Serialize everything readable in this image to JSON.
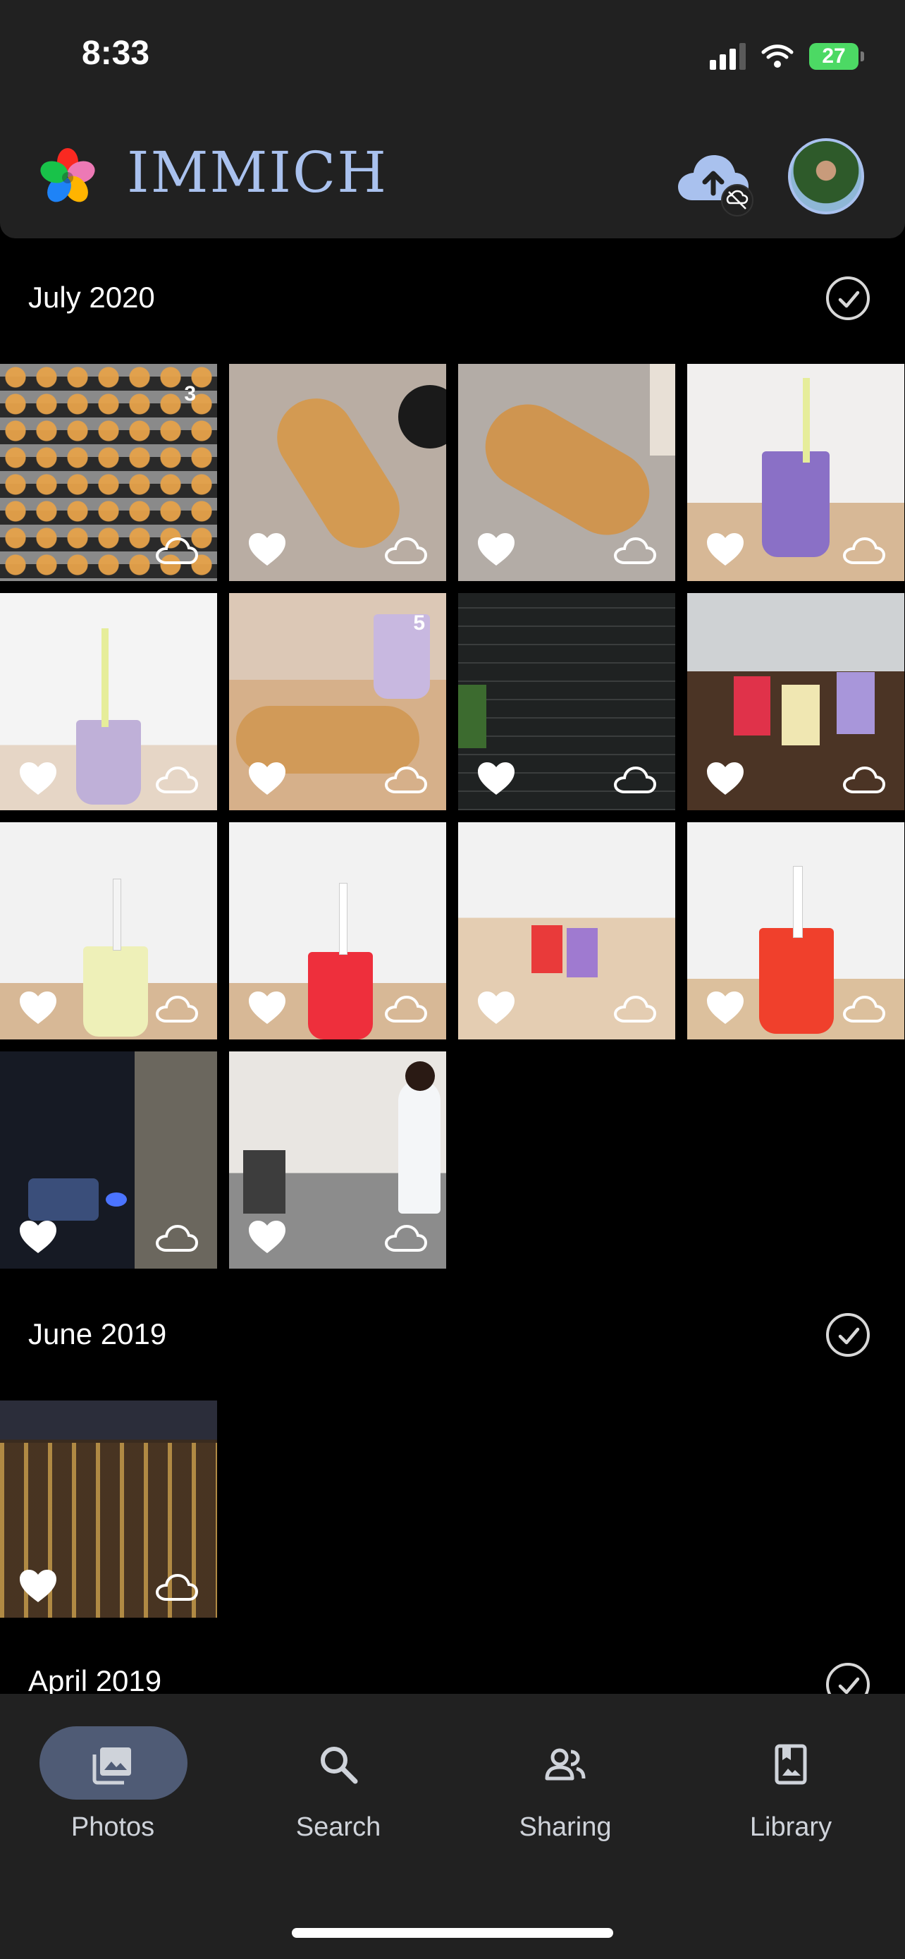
{
  "status_bar": {
    "time": "8:33",
    "battery": "27"
  },
  "app": {
    "brand": "IMMICH"
  },
  "sections": [
    {
      "title": "July 2020"
    },
    {
      "title": "June 2019"
    },
    {
      "title": "April 2019"
    }
  ],
  "stack_counts": {
    "tile_1": "3",
    "tile_6": "5"
  },
  "nav": {
    "photos": "Photos",
    "search": "Search",
    "sharing": "Sharing",
    "library": "Library"
  },
  "icons": {
    "favorite": "heart-icon",
    "backup": "cloud-icon",
    "upload": "cloud-upload-icon",
    "select": "check-circle-icon"
  },
  "colors": {
    "accent": "#a9c1ee",
    "nav_active": "#4f5b75",
    "topbar": "#212121"
  }
}
